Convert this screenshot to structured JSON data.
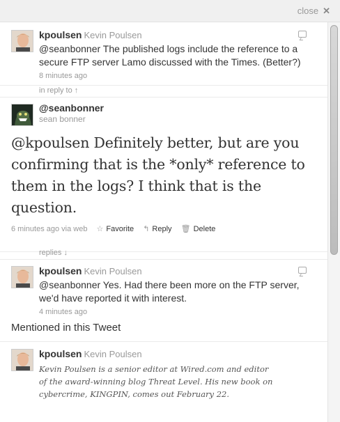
{
  "window": {
    "close_label": "close",
    "close_icon": "✕"
  },
  "parent_tweet": {
    "screen_name": "kpoulsen",
    "full_name": "Kevin Poulsen",
    "text": "@seanbonner The published logs include the reference to a secure FTP server Lamo discussed with the Times. (Better?)",
    "time": "8 minutes ago"
  },
  "in_reply_to_label": "in reply to ↑",
  "main_tweet": {
    "screen_name": "@seanbonner",
    "full_name": "sean bonner",
    "text": "@kpoulsen Definitely better, but are you confirming that is the *only* reference to them in the logs? I think that is the question.",
    "time": "6 minutes ago via web",
    "favorite_label": "Favorite",
    "reply_label": "Reply",
    "delete_label": "Delete"
  },
  "replies_label": "replies ↓",
  "reply_tweet": {
    "screen_name": "kpoulsen",
    "full_name": "Kevin Poulsen",
    "text": "@seanbonner Yes. Had there been more on the FTP server, we'd have reported it with interest.",
    "time": "4 minutes ago"
  },
  "mentioned_title": "Mentioned in this Tweet",
  "mentioned_user": {
    "screen_name": "kpoulsen",
    "full_name": "Kevin Poulsen",
    "bio": "Kevin Poulsen is a senior editor at Wired.com and editor of the award-winning blog Threat Level. His new book on cybercrime, KINGPIN, comes out February 22."
  },
  "colors": {
    "muted": "#999999",
    "text": "#333333",
    "topbar": "#f0f0f0"
  },
  "icons": [
    "reply-icon",
    "star-icon",
    "reply-arrow-icon",
    "trash-icon",
    "close-icon"
  ]
}
